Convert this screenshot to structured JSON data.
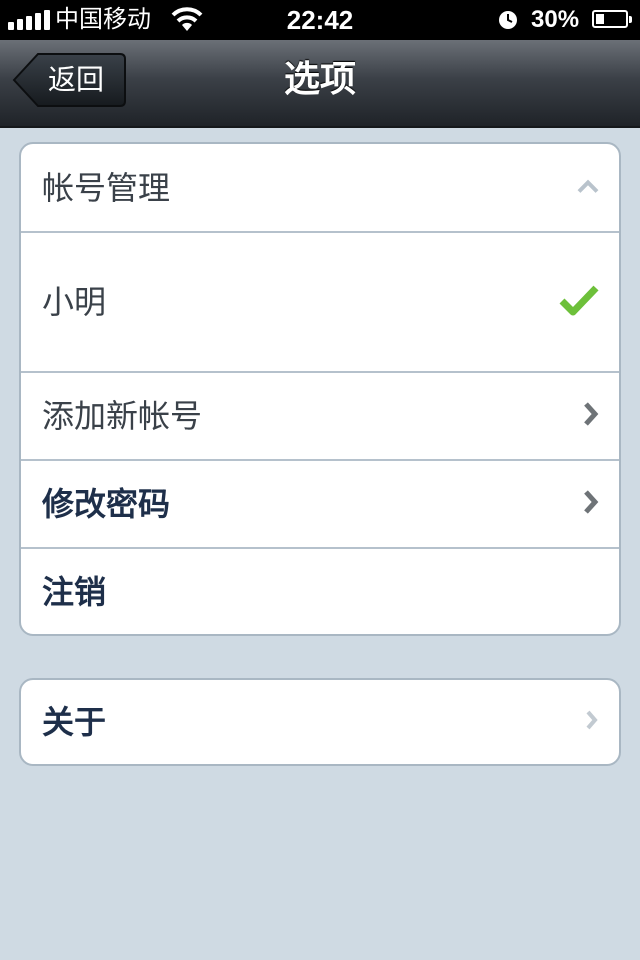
{
  "status_bar": {
    "carrier": "中国移动",
    "time": "22:42",
    "battery_percent": "30%",
    "battery_level": 0.3
  },
  "navbar": {
    "back_label": "返回",
    "title": "选项"
  },
  "account_group": {
    "header": "帐号管理",
    "current_account": "小明",
    "add_account": "添加新帐号",
    "change_password": "修改密码",
    "logout": "注销"
  },
  "about_group": {
    "about": "关于"
  },
  "icons": {
    "collapse": "chevron-up-icon",
    "selected": "checkmark-icon",
    "disclosure": "chevron-right-icon"
  },
  "colors": {
    "background": "#cfdae3",
    "checkmark": "#6dc03a",
    "navbar": "#2e3339"
  }
}
